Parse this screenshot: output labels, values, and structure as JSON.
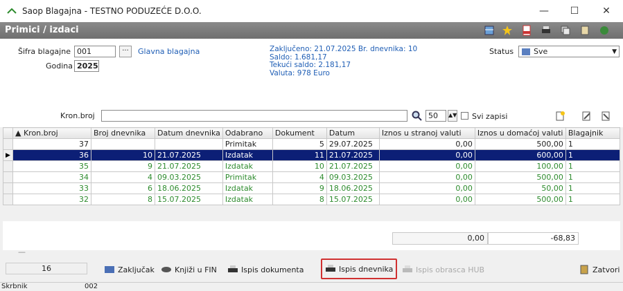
{
  "window": {
    "title": "Saop Blagajna - TESTNO PODUZEĆE D.O.O.",
    "minimize": "—",
    "maximize": "☐",
    "close": "✕"
  },
  "header": {
    "title": "Primici / izdaci"
  },
  "form": {
    "sifra_label": "Šifra blagajne",
    "sifra_value": "001",
    "sifra_name": "Glavna blagajna",
    "godina_label": "Godina",
    "godina_value": "2025",
    "info_lines": [
      "Zaključeno: 21.07.2025 Br. dnevnika: 10",
      "Saldo: 1.681,17",
      "Tekući saldo: 2.181,17",
      "Valuta: 978 Euro"
    ],
    "status_label": "Status",
    "status_value": "Sve"
  },
  "search": {
    "label": "Kron.broj",
    "value": "",
    "count": "50",
    "svi_zapisi": "Svi zapisi"
  },
  "table": {
    "columns": [
      "▲ Kron.broj",
      "Broj dnevnika",
      "Datum dnevnika",
      "Odabrano",
      "Dokument",
      "Datum",
      "Iznos u stranoj valuti",
      "Iznos u domaćoj valuti",
      "Blagajnik"
    ],
    "rows": [
      {
        "kron": "37",
        "broj": "",
        "datum_dn": "",
        "odabrano": "Primitak",
        "dokument": "5",
        "datum": "29.07.2025",
        "strana": "0,00",
        "domaca": "500,00",
        "blagajnik": "1"
      },
      {
        "kron": "36",
        "broj": "10",
        "datum_dn": "21.07.2025",
        "odabrano": "Izdatak",
        "dokument": "11",
        "datum": "21.07.2025",
        "strana": "0,00",
        "domaca": "600,00",
        "blagajnik": "1"
      },
      {
        "kron": "35",
        "broj": "9",
        "datum_dn": "21.07.2025",
        "odabrano": "Izdatak",
        "dokument": "10",
        "datum": "21.07.2025",
        "strana": "0,00",
        "domaca": "100,00",
        "blagajnik": "1"
      },
      {
        "kron": "34",
        "broj": "4",
        "datum_dn": "09.03.2025",
        "odabrano": "Primitak",
        "dokument": "4",
        "datum": "09.03.2025",
        "strana": "0,00",
        "domaca": "500,00",
        "blagajnik": "1"
      },
      {
        "kron": "33",
        "broj": "6",
        "datum_dn": "18.06.2025",
        "odabrano": "Izdatak",
        "dokument": "9",
        "datum": "18.06.2025",
        "strana": "0,00",
        "domaca": "50,00",
        "blagajnik": "1"
      },
      {
        "kron": "32",
        "broj": "8",
        "datum_dn": "15.07.2025",
        "odabrano": "Izdatak",
        "dokument": "8",
        "datum": "15.07.2025",
        "strana": "0,00",
        "domaca": "500,00",
        "blagajnik": "1"
      }
    ]
  },
  "summary": {
    "strana_total": "0,00",
    "domaca_total": "-68,83",
    "dash": "—"
  },
  "toolbar": {
    "count": "16",
    "zakljucak": "Zaključak",
    "knjizi": "Knjiži u FIN",
    "ispis_dokumenta": "Ispis dokumenta",
    "ispis_dnevnika": "Ispis dnevnika",
    "ispis_hub": "Ispis obrasca HUB",
    "zatvori": "Zatvori"
  },
  "status": {
    "label": "Skrbnik",
    "value": "002"
  },
  "colors": {
    "selected_row": "#0c1f76",
    "green_text": "#2d8b2d",
    "info_blue": "#1f5eb5",
    "highlight": "#d03030"
  }
}
